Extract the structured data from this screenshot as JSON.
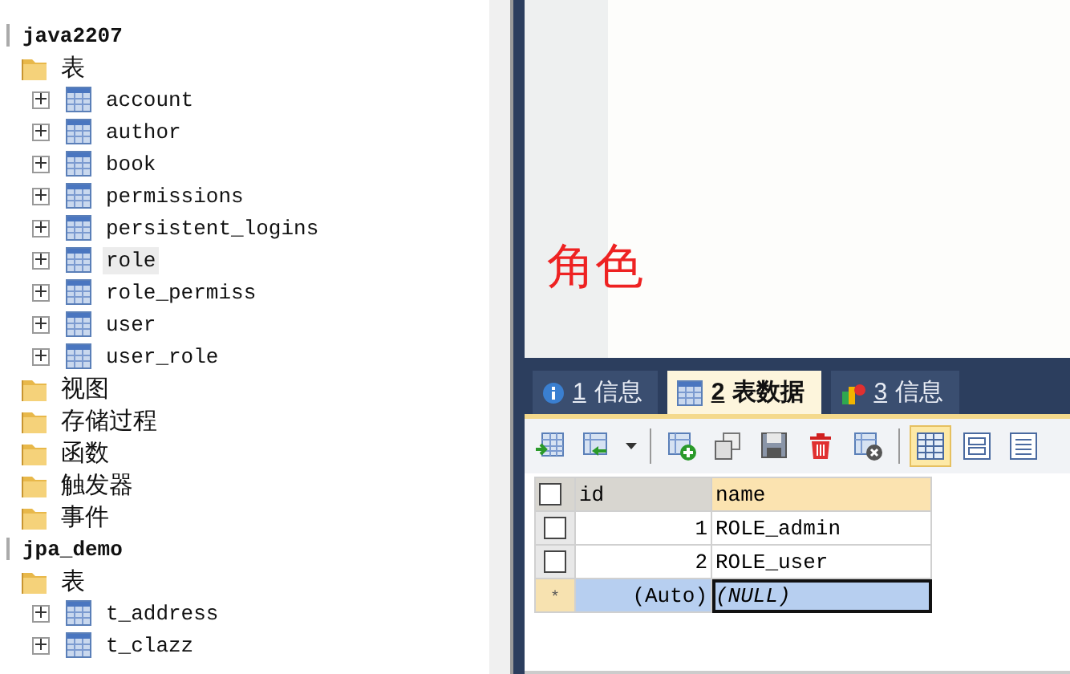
{
  "tree": [
    {
      "label": "java2207",
      "kind": "database",
      "children": [
        {
          "label": "表",
          "kind": "folder",
          "children": [
            {
              "label": "account",
              "kind": "table",
              "expanded": false,
              "selected": false
            },
            {
              "label": "author",
              "kind": "table",
              "expanded": false,
              "selected": false
            },
            {
              "label": "book",
              "kind": "table",
              "expanded": false,
              "selected": false
            },
            {
              "label": "permissions",
              "kind": "table",
              "expanded": false,
              "selected": false
            },
            {
              "label": "persistent_logins",
              "kind": "table",
              "expanded": false,
              "selected": false
            },
            {
              "label": "role",
              "kind": "table",
              "expanded": false,
              "selected": true
            },
            {
              "label": "role_permiss",
              "kind": "table",
              "expanded": false,
              "selected": false
            },
            {
              "label": "user",
              "kind": "table",
              "expanded": false,
              "selected": false
            },
            {
              "label": "user_role",
              "kind": "table",
              "expanded": false,
              "selected": false
            }
          ]
        },
        {
          "label": "视图",
          "kind": "folder"
        },
        {
          "label": "存储过程",
          "kind": "folder"
        },
        {
          "label": "函数",
          "kind": "folder"
        },
        {
          "label": "触发器",
          "kind": "folder"
        },
        {
          "label": "事件",
          "kind": "folder"
        }
      ]
    },
    {
      "label": "jpa_demo",
      "kind": "database",
      "children": [
        {
          "label": "表",
          "kind": "folder",
          "children": [
            {
              "label": "t_address",
              "kind": "table",
              "expanded": false,
              "selected": false
            },
            {
              "label": "t_clazz",
              "kind": "table",
              "expanded": false,
              "selected": false
            }
          ]
        }
      ]
    }
  ],
  "editor": {
    "annotation": "角色"
  },
  "tabs": [
    {
      "mnemonic": "1",
      "label": "信息",
      "kind": "info",
      "selected": false
    },
    {
      "mnemonic": "2",
      "label": "表数据",
      "kind": "table",
      "selected": true
    },
    {
      "mnemonic": "3",
      "label": "信息",
      "kind": "chart",
      "selected": false
    }
  ],
  "toolbar": [
    {
      "kind": "insert"
    },
    {
      "kind": "import"
    },
    {
      "kind": "dropdown"
    },
    {
      "kind": "separator"
    },
    {
      "kind": "add"
    },
    {
      "kind": "copy"
    },
    {
      "kind": "save"
    },
    {
      "kind": "delete"
    },
    {
      "kind": "cancel"
    },
    {
      "kind": "separator"
    },
    {
      "kind": "grid",
      "selected": true
    },
    {
      "kind": "form",
      "selected": false
    },
    {
      "kind": "text",
      "selected": false
    }
  ],
  "table": {
    "all_checked": false,
    "columns": [
      {
        "label": "id",
        "selected": false
      },
      {
        "label": "name",
        "selected": true
      }
    ],
    "rows": [
      {
        "kind": "record",
        "checked": false,
        "cells": [
          "1",
          "ROLE_admin"
        ]
      },
      {
        "kind": "record",
        "checked": false,
        "cells": [
          "2",
          "ROLE_user"
        ]
      },
      {
        "kind": "new",
        "marker": "*",
        "cells": [
          "(Auto)",
          "(NULL)"
        ]
      }
    ]
  }
}
